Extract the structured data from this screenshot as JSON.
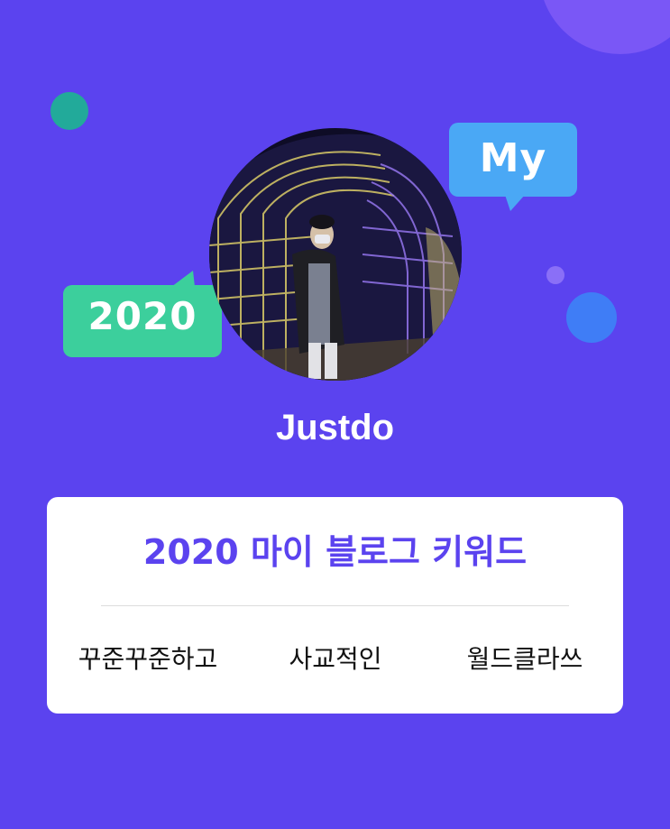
{
  "badges": {
    "my": "My",
    "year": "2020"
  },
  "profile": {
    "username": "Justdo"
  },
  "card": {
    "title": "2020 마이 블로그 키워드",
    "keywords": [
      "꾸준꾸준하고",
      "사교적인",
      "월드클라쓰"
    ]
  },
  "colors": {
    "background": "#5b43ef",
    "bubble_my": "#4aa8f5",
    "bubble_year": "#3ccf9c",
    "accent_text": "#5b43ef",
    "card": "#ffffff"
  }
}
